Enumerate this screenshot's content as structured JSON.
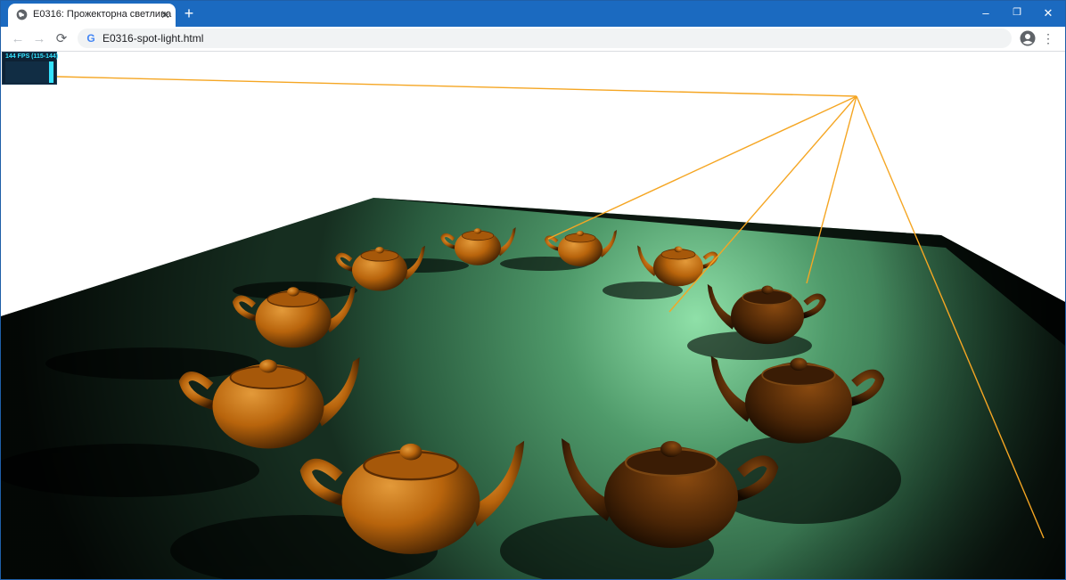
{
  "tab": {
    "title": "E0316: Прожекторна светлина",
    "favicon": "globe-icon",
    "close_icon": "close-icon"
  },
  "new_tab_icon": "plus-icon",
  "window_controls": {
    "minimize": "–",
    "restore": "❐",
    "close": "✕"
  },
  "toolbar": {
    "back": "←",
    "forward": "→",
    "reload": "⟳",
    "url": "E0316-spot-light.html",
    "search_engine_icon": "G",
    "menu": "⋮"
  },
  "stats": {
    "fps_label": "144 FPS (115-144)",
    "fps_fill": 1.0,
    "accent": "#34e3ff"
  },
  "scene": {
    "floor_color": "#2e6a48",
    "spotlight_color": "#8fe0a8",
    "teapot_color": "#b8640c",
    "helper_line_color": "#f5a623",
    "teapot_count": 10
  }
}
